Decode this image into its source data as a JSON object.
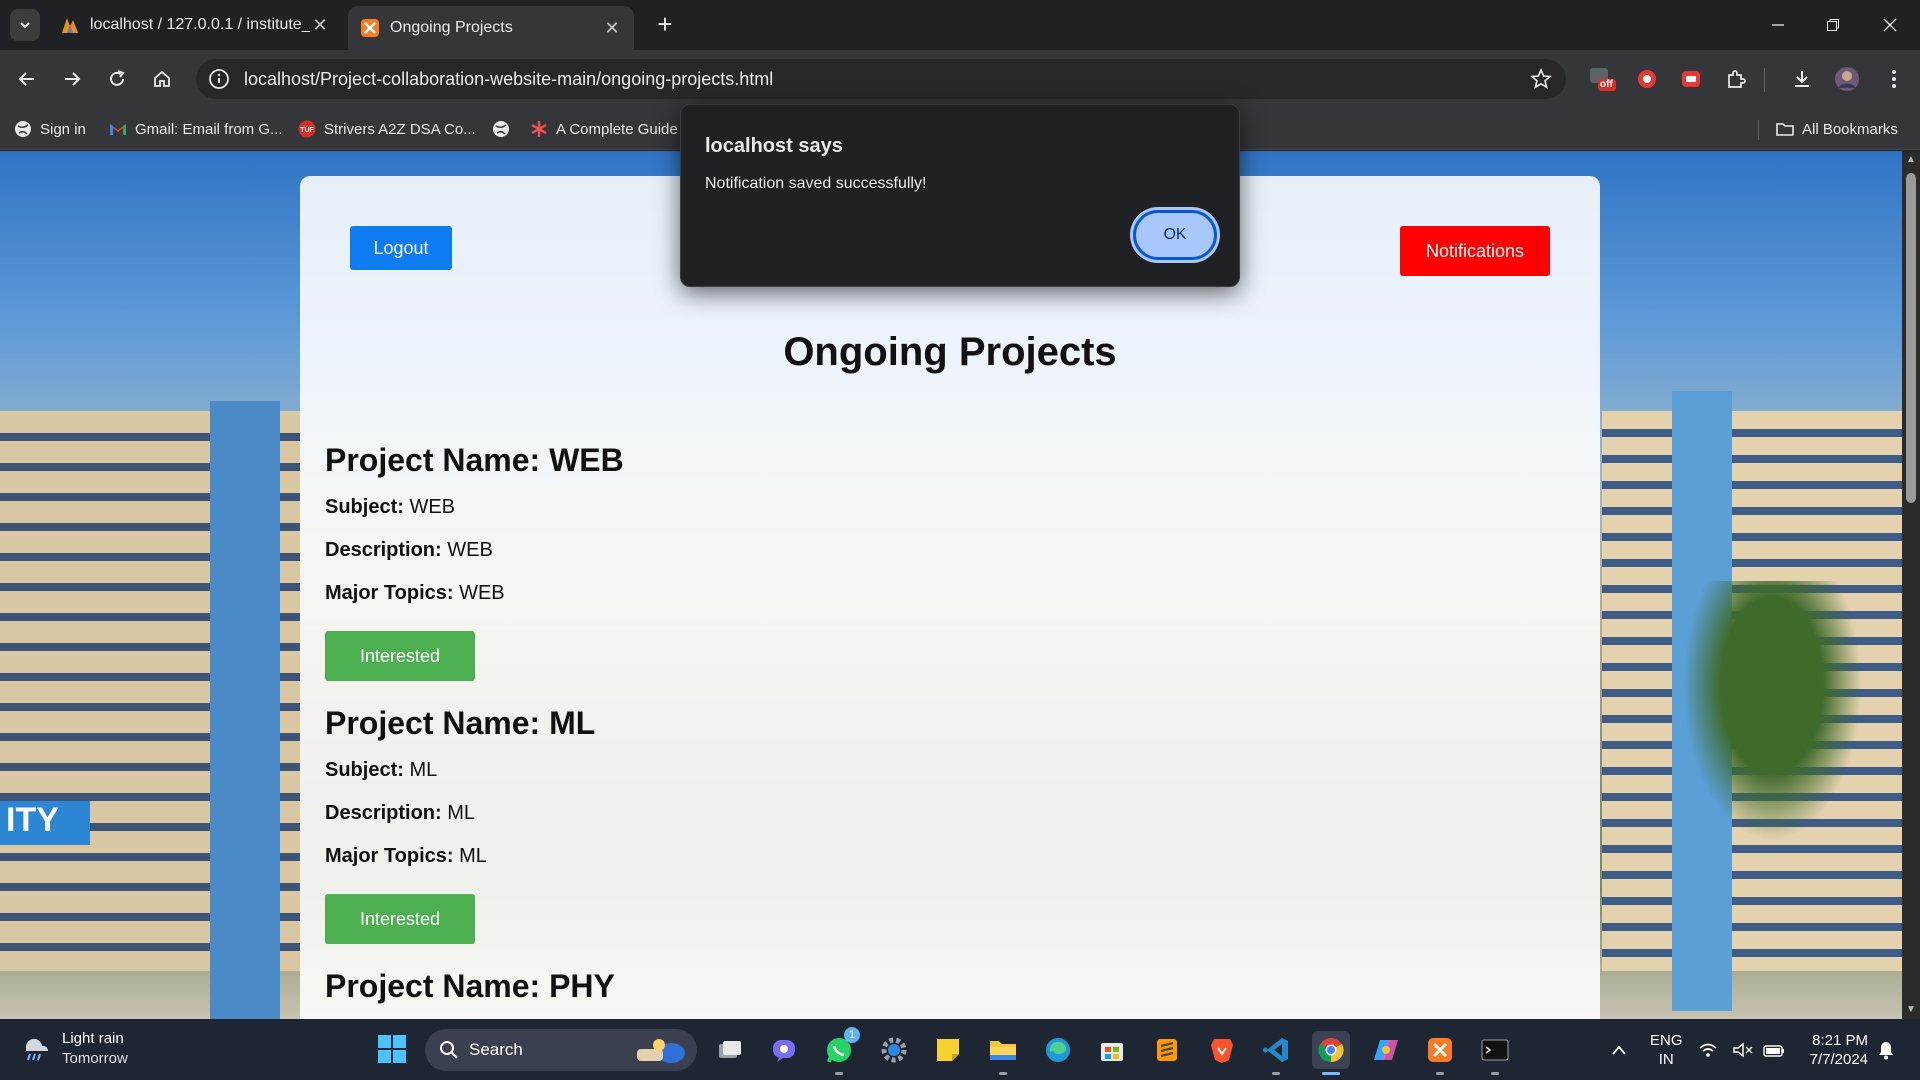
{
  "browser": {
    "tabs": [
      {
        "title": "localhost / 127.0.0.1 / institute_",
        "active": false
      },
      {
        "title": "Ongoing Projects",
        "active": true
      }
    ],
    "url": "localhost/Project-collaboration-website-main/ongoing-projects.html",
    "bookmarks": [
      {
        "label": "Sign in"
      },
      {
        "label": "Gmail: Email from G..."
      },
      {
        "label": "Strivers A2Z DSA Co..."
      },
      {
        "label": ""
      },
      {
        "label": "A Complete Guide"
      }
    ],
    "all_bookmarks_label": "All Bookmarks",
    "extension_badge": "off"
  },
  "dialog": {
    "title": "localhost says",
    "message": "Notification saved successfully!",
    "ok_label": "OK"
  },
  "page": {
    "logout_label": "Logout",
    "notifications_label": "Notifications",
    "title": "Ongoing Projects",
    "labels": {
      "project_name": "Project Name:",
      "subject": "Subject:",
      "description": "Description:",
      "major_topics": "Major Topics:"
    },
    "interested_label": "Interested",
    "background_sign_text": "ITY",
    "projects": [
      {
        "name": "WEB",
        "subject": "WEB",
        "description": "WEB",
        "major_topics": "WEB"
      },
      {
        "name": "ML",
        "subject": "ML",
        "description": "ML",
        "major_topics": "ML"
      },
      {
        "name": "PHY"
      }
    ]
  },
  "taskbar": {
    "weather": {
      "line1": "Light rain",
      "line2": "Tomorrow"
    },
    "search_label": "Search",
    "whatsapp_badge": "1",
    "language": {
      "line1": "ENG",
      "line2": "IN"
    },
    "clock": {
      "time": "8:21 PM",
      "date": "7/7/2024"
    }
  }
}
